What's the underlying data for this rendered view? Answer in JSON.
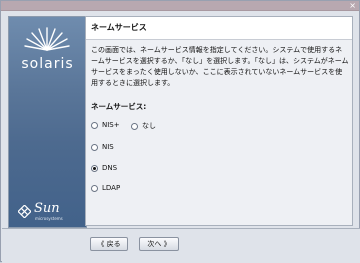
{
  "window": {
    "close": "×"
  },
  "side": {
    "brand": "solaris",
    "sun_word": "Sun",
    "sun_sub": "microsystems"
  },
  "header": {
    "title": "ネームサービス"
  },
  "description": "この画面では、ネームサービス情報を指定してください。システムで使用するネームサービスを選択するか、「なし」を選択します。「なし」は、システムがネームサービスをまったく使用しないか、ここに表示されていないネームサービスを使用するときに選択します。",
  "options_label": "ネームサービス:",
  "options": [
    {
      "label": "NIS+",
      "selected": false
    },
    {
      "label": "なし",
      "selected": false
    },
    {
      "label": "NIS",
      "selected": false
    },
    {
      "label": "DNS",
      "selected": true
    },
    {
      "label": "LDAP",
      "selected": false
    }
  ],
  "buttons": {
    "back": "《 戻る",
    "next": "次へ 》"
  }
}
